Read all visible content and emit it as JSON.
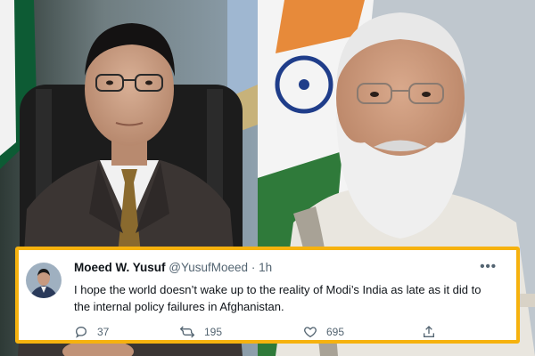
{
  "tweet": {
    "author_name": "Moeed W. Yusuf",
    "handle": "@YusufMoeed",
    "separator": "·",
    "timestamp": "1h",
    "text": "I hope the world doesn’t wake up to the reality of Modi’s India as late as it did to the internal policy failures in Afghanistan.",
    "more_icon": "more-horizontal-icon",
    "actions": {
      "replies": {
        "icon": "reply-icon",
        "count": "37"
      },
      "retweets": {
        "icon": "retweet-icon",
        "count": "195"
      },
      "likes": {
        "icon": "heart-icon",
        "count": "695"
      },
      "share": {
        "icon": "share-icon"
      }
    }
  },
  "colors": {
    "card_border": "#f6b20e",
    "text_primary": "#0f1419",
    "text_secondary": "#536471"
  }
}
